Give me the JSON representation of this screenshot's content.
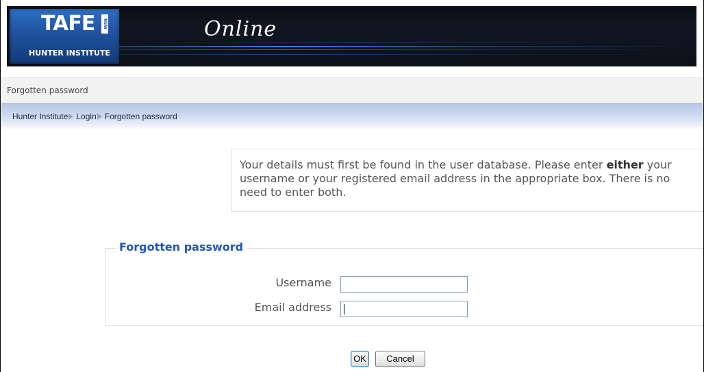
{
  "header": {
    "logo_text": "TAFE",
    "logo_nsw": "NSW",
    "logo_subtitle": "HUNTER INSTITUTE",
    "title": "Online"
  },
  "page_title": "Forgotten password",
  "breadcrumb": {
    "items": [
      {
        "label": "Hunter Institute"
      },
      {
        "label": "Login"
      },
      {
        "label": "Forgotten password"
      }
    ]
  },
  "info": {
    "text_before": "Your details must first be found in the user database. Please enter ",
    "text_bold": "either",
    "text_after": " your username or your registered email address in the appropriate box. There is no need to enter both."
  },
  "form": {
    "legend": "Forgotten password",
    "username_label": "Username",
    "username_value": "",
    "email_label": "Email address",
    "email_value": ""
  },
  "buttons": {
    "ok_label": "OK",
    "cancel_label": "Cancel"
  },
  "colors": {
    "legend": "#2255bb",
    "banner": "#0b1018",
    "logo": "#1d4f9a"
  }
}
